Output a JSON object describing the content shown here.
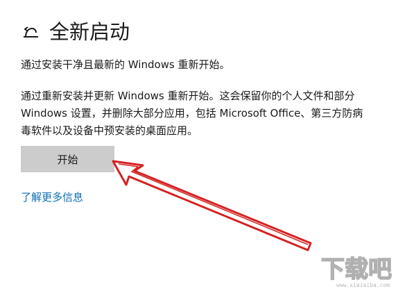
{
  "header": {
    "title": "全新启动",
    "icon": "fresh-start-icon"
  },
  "subtitle": "通过安装干净且最新的 Windows 重新开始。",
  "description": {
    "lines": [
      "通过重新安装并更新 Windows 重新开始。这会保留你的个人文件和部分",
      "Windows 设置，并删除大部分应用，包括 Microsoft Office、第三方防病",
      "毒软件以及设备中预安装的桌面应用。"
    ]
  },
  "start_button": {
    "label": "开始"
  },
  "learn_more": {
    "label": "了解更多信息"
  },
  "annotation": {
    "arrow_color": "#d42222"
  },
  "watermark": {
    "text": "下载吧"
  },
  "colors": {
    "link": "#0a6fb5",
    "button_bg": "#cccccc",
    "text": "#1a1a1a"
  }
}
